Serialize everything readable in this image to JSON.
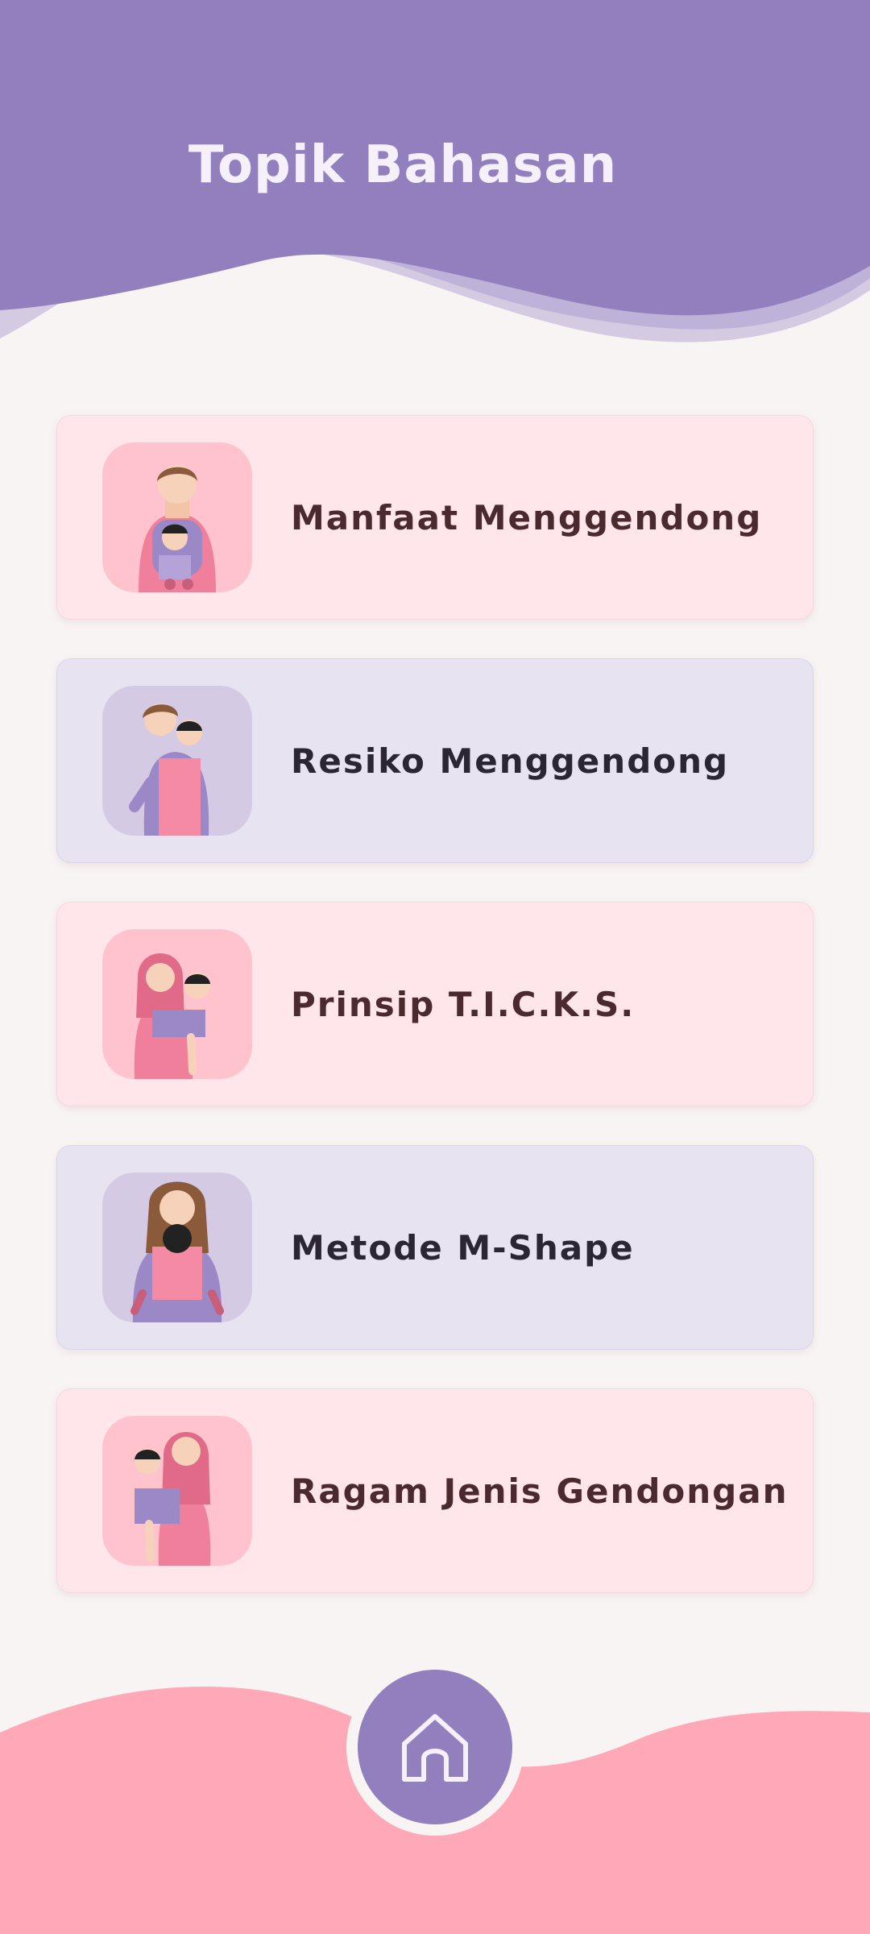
{
  "header": {
    "title": "Topik Bahasan"
  },
  "topics": [
    {
      "label": "Manfaat Menggendong",
      "icon": "father-carrying-baby-illustration",
      "theme": "pink"
    },
    {
      "label": "Resiko Menggendong",
      "icon": "mother-back-carry-illustration",
      "theme": "lavender"
    },
    {
      "label": "Prinsip T.I.C.K.S.",
      "icon": "hijab-mother-hip-carry-illustration",
      "theme": "pink"
    },
    {
      "label": "Metode M-Shape",
      "icon": "mother-front-carry-illustration",
      "theme": "lavender"
    },
    {
      "label": "Ragam Jenis Gendongan",
      "icon": "hijab-mother-side-carry-illustration",
      "theme": "pink"
    }
  ],
  "footer": {
    "home_icon": "home-icon"
  },
  "colors": {
    "header": "#9280be",
    "footer": "#ffa8b7",
    "background": "#f9f4f4",
    "card_pink": "#fee6ea",
    "card_lavender": "#e8e3f1"
  }
}
